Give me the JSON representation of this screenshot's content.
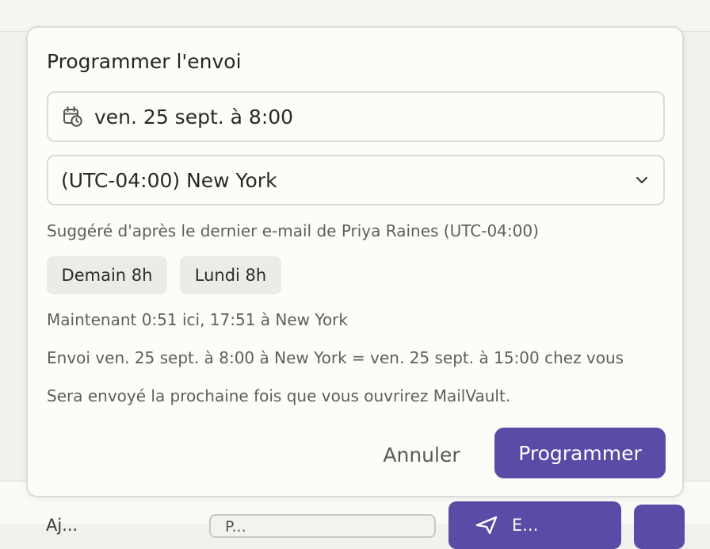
{
  "dialog": {
    "title": "Programmer l'envoi",
    "date_value": "ven. 25 sept. à 8:00",
    "timezone_value": "(UTC-04:00) New York",
    "suggestion": "Suggéré d'après le dernier e-mail de Priya Raines (UTC-04:00)",
    "chips": [
      "Demain 8h",
      "Lundi 8h"
    ],
    "now_line": "Maintenant 0:51 ici, 17:51 à New York",
    "conversion_line": "Envoi ven. 25 sept. à 8:00 à New York = ven. 25 sept. à 15:00 chez vous",
    "offline_note": "Sera envoyé la prochaine fois que vous ouvrirez MailVault.",
    "cancel_label": "Annuler",
    "submit_label": "Programmer"
  },
  "background": {
    "bottom_text": "Aj...",
    "select_text": "P...",
    "send_label": "E..."
  },
  "colors": {
    "accent": "#5b4aa6",
    "surface": "#fdfcf8",
    "chip": "#ecebe7"
  },
  "icons": {
    "date": "calendar-clock-icon",
    "timezone": "chevron-down-icon"
  }
}
